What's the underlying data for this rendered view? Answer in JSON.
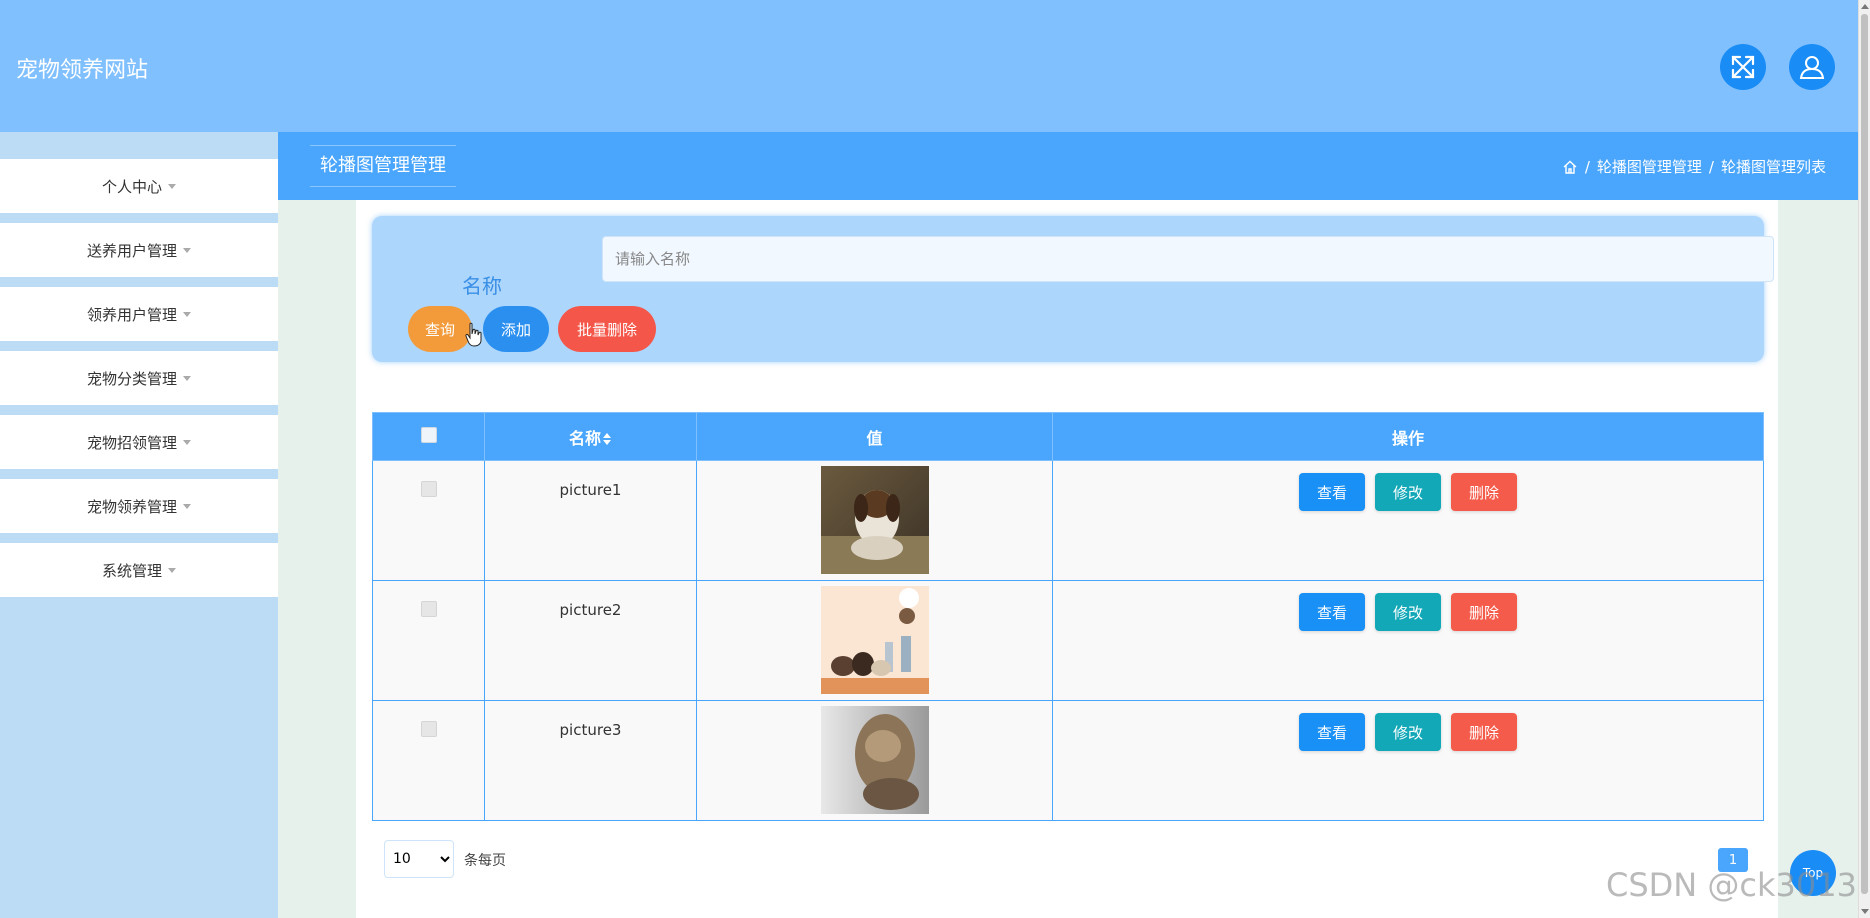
{
  "header": {
    "site_title": "宠物领养网站",
    "fullscreen_icon": "expand-icon",
    "user_icon": "user-icon"
  },
  "sidebar": {
    "items": [
      {
        "label": "个人中心"
      },
      {
        "label": "送养用户管理"
      },
      {
        "label": "领养用户管理"
      },
      {
        "label": "宠物分类管理"
      },
      {
        "label": "宠物招领管理"
      },
      {
        "label": "宠物领养管理"
      },
      {
        "label": "系统管理"
      }
    ]
  },
  "breadcrumb": {
    "page_title": "轮播图管理管理",
    "home_icon": "home-icon",
    "items": [
      "轮播图管理管理",
      "轮播图管理列表"
    ],
    "separator": "/"
  },
  "search": {
    "label": "名称",
    "placeholder": "请输入名称",
    "value": "",
    "query_label": "查询",
    "add_label": "添加",
    "batch_delete_label": "批量删除"
  },
  "table": {
    "headers": {
      "name": "名称",
      "value": "值",
      "actions": "操作"
    },
    "rows": [
      {
        "name": "picture1"
      },
      {
        "name": "picture2"
      },
      {
        "name": "picture3"
      }
    ],
    "view_label": "查看",
    "edit_label": "修改",
    "delete_label": "删除"
  },
  "pagination": {
    "page_size": "10",
    "per_page_label": "条每页",
    "current_page": "1"
  },
  "back_to_top_label": "Top",
  "watermark": "CSDN @ck3013",
  "colors": {
    "header_bg": "#80c0ff",
    "primary": "#4aa6fc",
    "query": "#f39b3a",
    "add": "#2b8ff0",
    "danger": "#f4574a",
    "edit": "#13a8b8"
  }
}
